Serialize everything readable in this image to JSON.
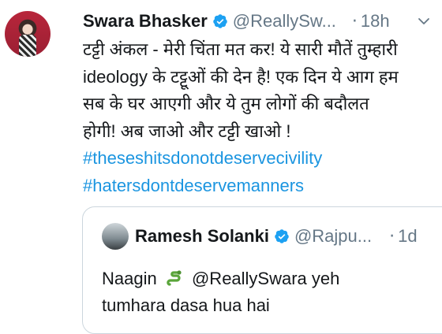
{
  "tweet": {
    "author_name": "Swara Bhasker",
    "author_handle": "@ReallySw...",
    "separator": "·",
    "time": "18h",
    "text_lines": [
      "टट्टी अंकल - मेरी चिंता मत कर! ये सारी मौतें तुम्हारी",
      "ideology के टट्टूओं की देन है! एक दिन ये आग हम",
      "सब के घर आएगी और ये तुम लोगों की बदौलत",
      "होगी! अब जाओ और टट्टी खाओ !"
    ],
    "hashtags": [
      "#theseshitsdonotdeservecivility",
      "#hatersdontdeservemanners"
    ]
  },
  "quoted_tweet": {
    "author_name": "Ramesh Solanki",
    "author_handle": "@Rajpu...",
    "separator": "·",
    "time": "1d",
    "line1_start": "Naagin",
    "line1_end": "@ReallySwara yeh",
    "line2": "tumhara dasa hua hai"
  },
  "colors": {
    "link": "#1b95e0",
    "secondary_text": "#657786",
    "verified": "#1da1f2"
  },
  "icons": [
    "verified-badge-icon",
    "chevron-down-icon",
    "snake-emoji-icon"
  ]
}
